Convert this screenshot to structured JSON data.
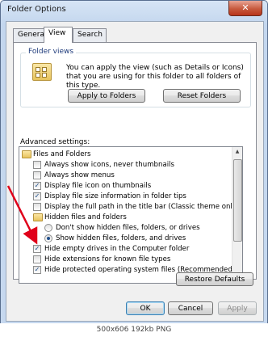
{
  "window": {
    "title": "Folder Options",
    "close_glyph": "✕"
  },
  "tabs": [
    "General",
    "View",
    "Search"
  ],
  "folder_views": {
    "legend": "Folder views",
    "description": "You can apply the view (such as Details or Icons) that you are using for this folder to all folders of this type.",
    "apply_button": "Apply to Folders",
    "reset_button": "Reset Folders"
  },
  "advanced": {
    "label": "Advanced settings:",
    "items": [
      {
        "type": "folder",
        "label": "Files and Folders"
      },
      {
        "type": "checkbox",
        "checked": false,
        "label": "Always show icons, never thumbnails"
      },
      {
        "type": "checkbox",
        "checked": false,
        "label": "Always show menus"
      },
      {
        "type": "checkbox",
        "checked": true,
        "label": "Display file icon on thumbnails"
      },
      {
        "type": "checkbox",
        "checked": true,
        "label": "Display file size information in folder tips"
      },
      {
        "type": "checkbox",
        "checked": false,
        "label": "Display the full path in the title bar (Classic theme only)"
      },
      {
        "type": "folder",
        "label": "Hidden files and folders"
      },
      {
        "type": "radio",
        "checked": false,
        "label": "Don't show hidden files, folders, or drives"
      },
      {
        "type": "radio",
        "checked": true,
        "label": "Show hidden files, folders, and drives"
      },
      {
        "type": "checkbox",
        "checked": true,
        "label": "Hide empty drives in the Computer folder"
      },
      {
        "type": "checkbox",
        "checked": false,
        "label": "Hide extensions for known file types"
      },
      {
        "type": "checkbox",
        "checked": true,
        "label": "Hide protected operating system files (Recommended)"
      }
    ]
  },
  "buttons": {
    "restore_defaults": "Restore Defaults",
    "ok": "OK",
    "cancel": "Cancel",
    "apply": "Apply"
  },
  "status_bar": "500x606 192kb PNG",
  "colors": {
    "annotation_arrow": "#e0001a"
  },
  "icons": {
    "window_close": "close-icon",
    "folder": "folder-icon",
    "folder_view": "folder-view-icon"
  }
}
